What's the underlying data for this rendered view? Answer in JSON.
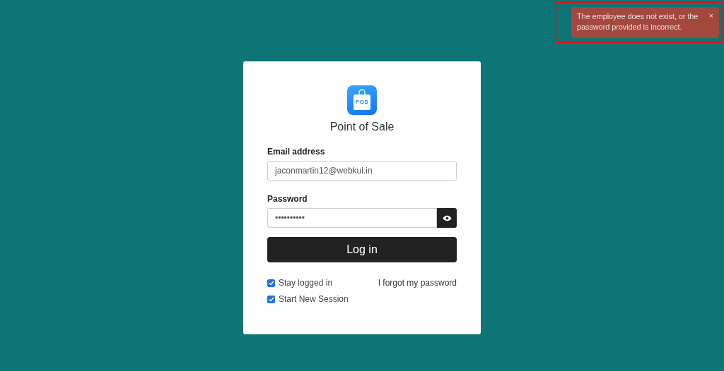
{
  "toast": {
    "message": "The employee does not exist, or the password provided is incorrect.",
    "close": "×"
  },
  "login": {
    "logo_text": "POS",
    "title": "Point of Sale",
    "email": {
      "label": "Email address",
      "value": "jaconmartin12@webkul.in"
    },
    "password": {
      "label": "Password",
      "value": "••••••••••"
    },
    "submit": "Log in",
    "options": [
      {
        "label": "Stay logged in",
        "checked": true
      },
      {
        "label": "Start New Session",
        "checked": true
      }
    ],
    "forgot_link": "I forgot my password"
  }
}
